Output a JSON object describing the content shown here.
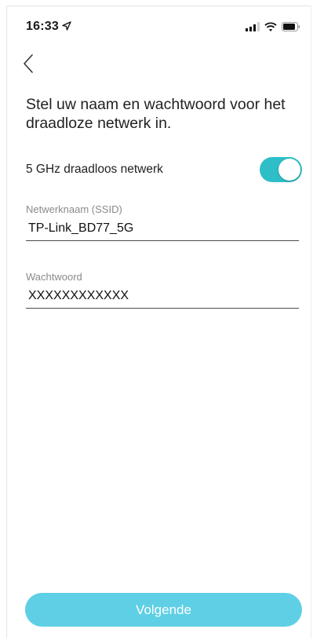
{
  "status_bar": {
    "time": "16:33",
    "icons": [
      "location-arrow-icon",
      "signal-icon",
      "wifi-icon",
      "battery-icon"
    ]
  },
  "nav": {
    "back_icon": "chevron-left-icon"
  },
  "page": {
    "title": "Stel uw naam en wachtwoord voor het draadloze netwerk in."
  },
  "band_toggle": {
    "label": "5 GHz draadloos netwerk",
    "enabled": true,
    "accent_color": "#2dbec8"
  },
  "ssid_field": {
    "label": "Netwerknaam (SSID)",
    "value": "TP-Link_BD77_5G"
  },
  "password_field": {
    "label": "Wachtwoord",
    "value": "XXXXXXXXXXXX"
  },
  "footer": {
    "next_label": "Volgende",
    "button_color": "#5fcfe5"
  }
}
